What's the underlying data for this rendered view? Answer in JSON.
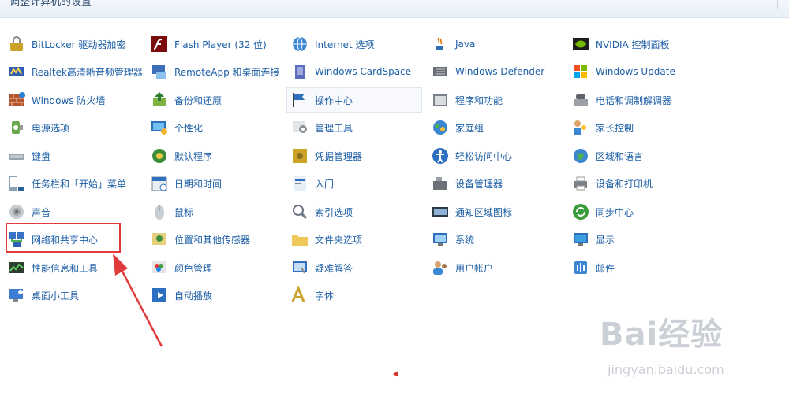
{
  "window": {
    "title": "调整计算机的设置"
  },
  "columns": [
    [
      {
        "label": "BitLocker 驱动器加密",
        "icon": "bitlocker-icon"
      },
      {
        "label": "Realtek高清晰音频管理器",
        "icon": "realtek-audio-icon"
      },
      {
        "label": "Windows 防火墙",
        "icon": "firewall-icon"
      },
      {
        "label": "电源选项",
        "icon": "power-options-icon"
      },
      {
        "label": "键盘",
        "icon": "keyboard-icon"
      },
      {
        "label": "任务栏和「开始」菜单",
        "icon": "taskbar-icon"
      },
      {
        "label": "声音",
        "icon": "sound-icon"
      },
      {
        "label": "网络和共享中心",
        "icon": "network-icon"
      },
      {
        "label": "性能信息和工具",
        "icon": "performance-icon"
      },
      {
        "label": "桌面小工具",
        "icon": "gadgets-icon"
      }
    ],
    [
      {
        "label": "Flash Player (32 位)",
        "icon": "flash-icon"
      },
      {
        "label": "RemoteApp 和桌面连接",
        "icon": "remoteapp-icon"
      },
      {
        "label": "备份和还原",
        "icon": "backup-icon"
      },
      {
        "label": "个性化",
        "icon": "personalization-icon"
      },
      {
        "label": "默认程序",
        "icon": "default-programs-icon"
      },
      {
        "label": "日期和时间",
        "icon": "calendar-icon"
      },
      {
        "label": "鼠标",
        "icon": "mouse-icon"
      },
      {
        "label": "位置和其他传感器",
        "icon": "sensor-icon"
      },
      {
        "label": "颜色管理",
        "icon": "color-icon"
      },
      {
        "label": "自动播放",
        "icon": "autoplay-icon"
      }
    ],
    [
      {
        "label": "Internet 选项",
        "icon": "internet-options-icon"
      },
      {
        "label": "Windows CardSpace",
        "icon": "cardspace-icon"
      },
      {
        "label": "操作中心",
        "icon": "flag-icon"
      },
      {
        "label": "管理工具",
        "icon": "admin-tools-icon"
      },
      {
        "label": "凭据管理器",
        "icon": "vault-icon"
      },
      {
        "label": "入门",
        "icon": "getting-started-icon"
      },
      {
        "label": "索引选项",
        "icon": "indexing-icon"
      },
      {
        "label": "文件夹选项",
        "icon": "folder-icon"
      },
      {
        "label": "疑难解答",
        "icon": "troubleshoot-icon"
      },
      {
        "label": "字体",
        "icon": "font-icon"
      }
    ],
    [
      {
        "label": "Java",
        "icon": "java-icon"
      },
      {
        "label": "Windows Defender",
        "icon": "defender-icon"
      },
      {
        "label": "程序和功能",
        "icon": "programs-icon"
      },
      {
        "label": "家庭组",
        "icon": "homegroup-icon"
      },
      {
        "label": "轻松访问中心",
        "icon": "ease-access-icon"
      },
      {
        "label": "设备管理器",
        "icon": "device-manager-icon"
      },
      {
        "label": "通知区域图标",
        "icon": "notification-icon"
      },
      {
        "label": "系统",
        "icon": "system-icon"
      },
      {
        "label": "用户帐户",
        "icon": "user-accounts-icon"
      }
    ],
    [
      {
        "label": "NVIDIA 控制面板",
        "icon": "nvidia-icon"
      },
      {
        "label": "Windows Update",
        "icon": "windows-update-icon"
      },
      {
        "label": "电话和调制解调器",
        "icon": "phone-modem-icon"
      },
      {
        "label": "家长控制",
        "icon": "parental-controls-icon"
      },
      {
        "label": "区域和语言",
        "icon": "region-icon"
      },
      {
        "label": "设备和打印机",
        "icon": "printer-icon"
      },
      {
        "label": "同步中心",
        "icon": "sync-icon"
      },
      {
        "label": "显示",
        "icon": "display-icon"
      },
      {
        "label": "邮件",
        "icon": "mail-icon"
      }
    ]
  ],
  "colors": {
    "link": "#1d5fa6",
    "highlight": "#e03a3a"
  },
  "watermark": {
    "logo": "Bai经验",
    "url": "jingyan.baidu.com"
  }
}
